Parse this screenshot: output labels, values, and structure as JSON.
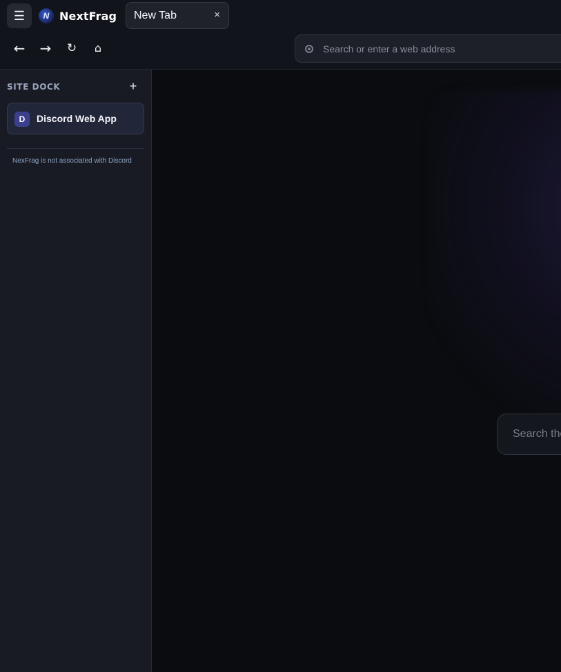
{
  "app": {
    "name": "NextFrag",
    "logo_icon": "nextfrag-logo-icon",
    "logo_glyph": "N"
  },
  "toolbar": {
    "menu_glyph": "☰",
    "menu_icon": "hamburger-menu-icon"
  },
  "tabs": [
    {
      "title": "New Tab",
      "close_glyph": "×"
    }
  ],
  "nav": {
    "back_glyph": "←",
    "forward_glyph": "→",
    "reload_glyph": "↻",
    "home_glyph": "⌂"
  },
  "address_bar": {
    "value": "",
    "placeholder": "Search or enter a web address",
    "icon": "search-engine-icon"
  },
  "sidebar": {
    "title": "SITE DOCK",
    "add_glyph": "+",
    "items": [
      {
        "icon_letter": "D",
        "label": "Discord Web App"
      }
    ],
    "note": "NexFrag is not associated with Discord"
  },
  "main": {
    "search_placeholder": "Search the",
    "search_value": ""
  },
  "colors": {
    "background": "#0b0c10",
    "sidebar": "#191b24",
    "accent": "#3b3f8c"
  }
}
